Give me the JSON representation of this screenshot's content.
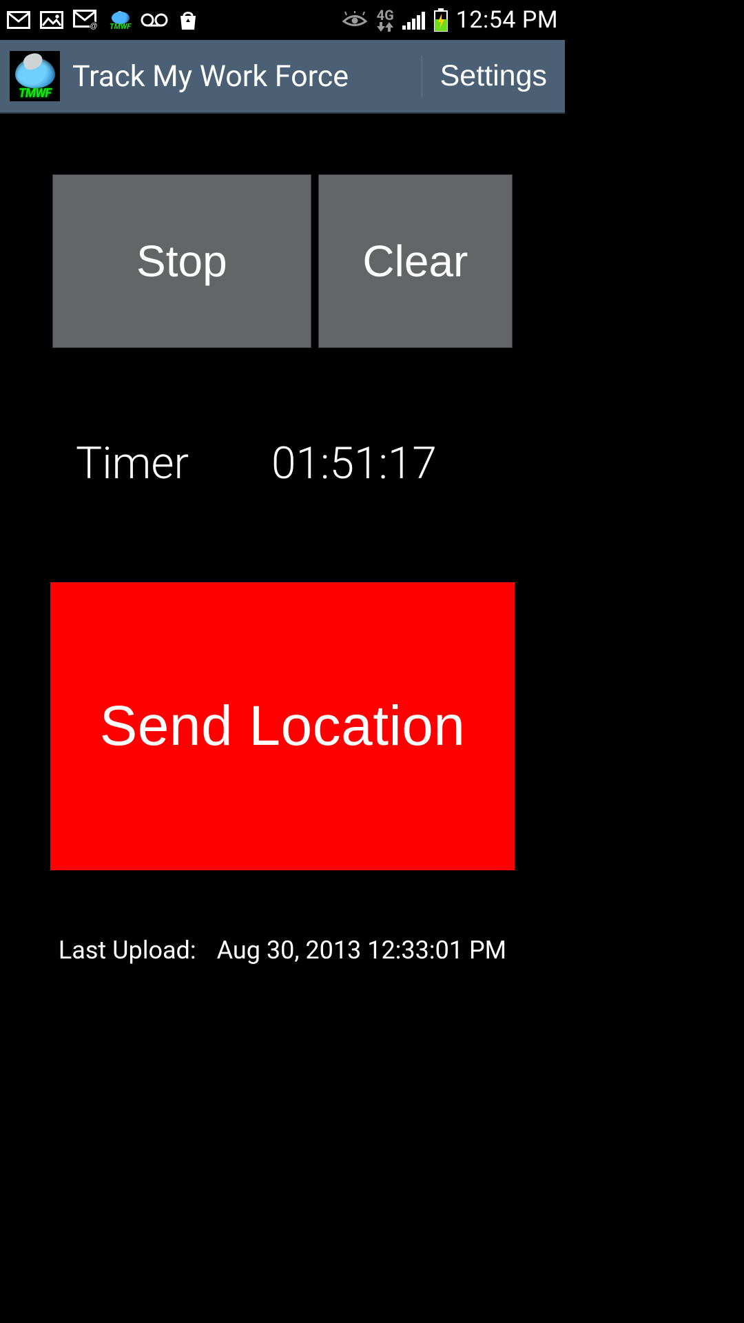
{
  "status_bar": {
    "network_label": "4G",
    "clock": "12:54 PM",
    "icons": {
      "mail1": "mail-icon",
      "image": "image-icon",
      "mail_at": "mail-at-icon",
      "app_tiny": "TMWF",
      "voicemail": "voicemail-icon",
      "store": "shopping-bag-icon",
      "visibility": "eye-icon",
      "signal": "cellular-signal-icon",
      "battery": "battery-charging-icon"
    }
  },
  "action_bar": {
    "title": "Track My Work Force",
    "settings_label": "Settings",
    "icon_text": "TMWF"
  },
  "buttons": {
    "stop": "Stop",
    "clear": "Clear",
    "send_location": "Send Location"
  },
  "timer": {
    "label": "Timer",
    "value": "01:51:17"
  },
  "last_upload": {
    "label": "Last Upload:",
    "value": "Aug 30, 2013 12:33:01 PM"
  },
  "colors": {
    "action_bar_bg": "#4b6075",
    "gray_btn_bg": "#636567",
    "send_btn_bg": "#ff0000"
  }
}
